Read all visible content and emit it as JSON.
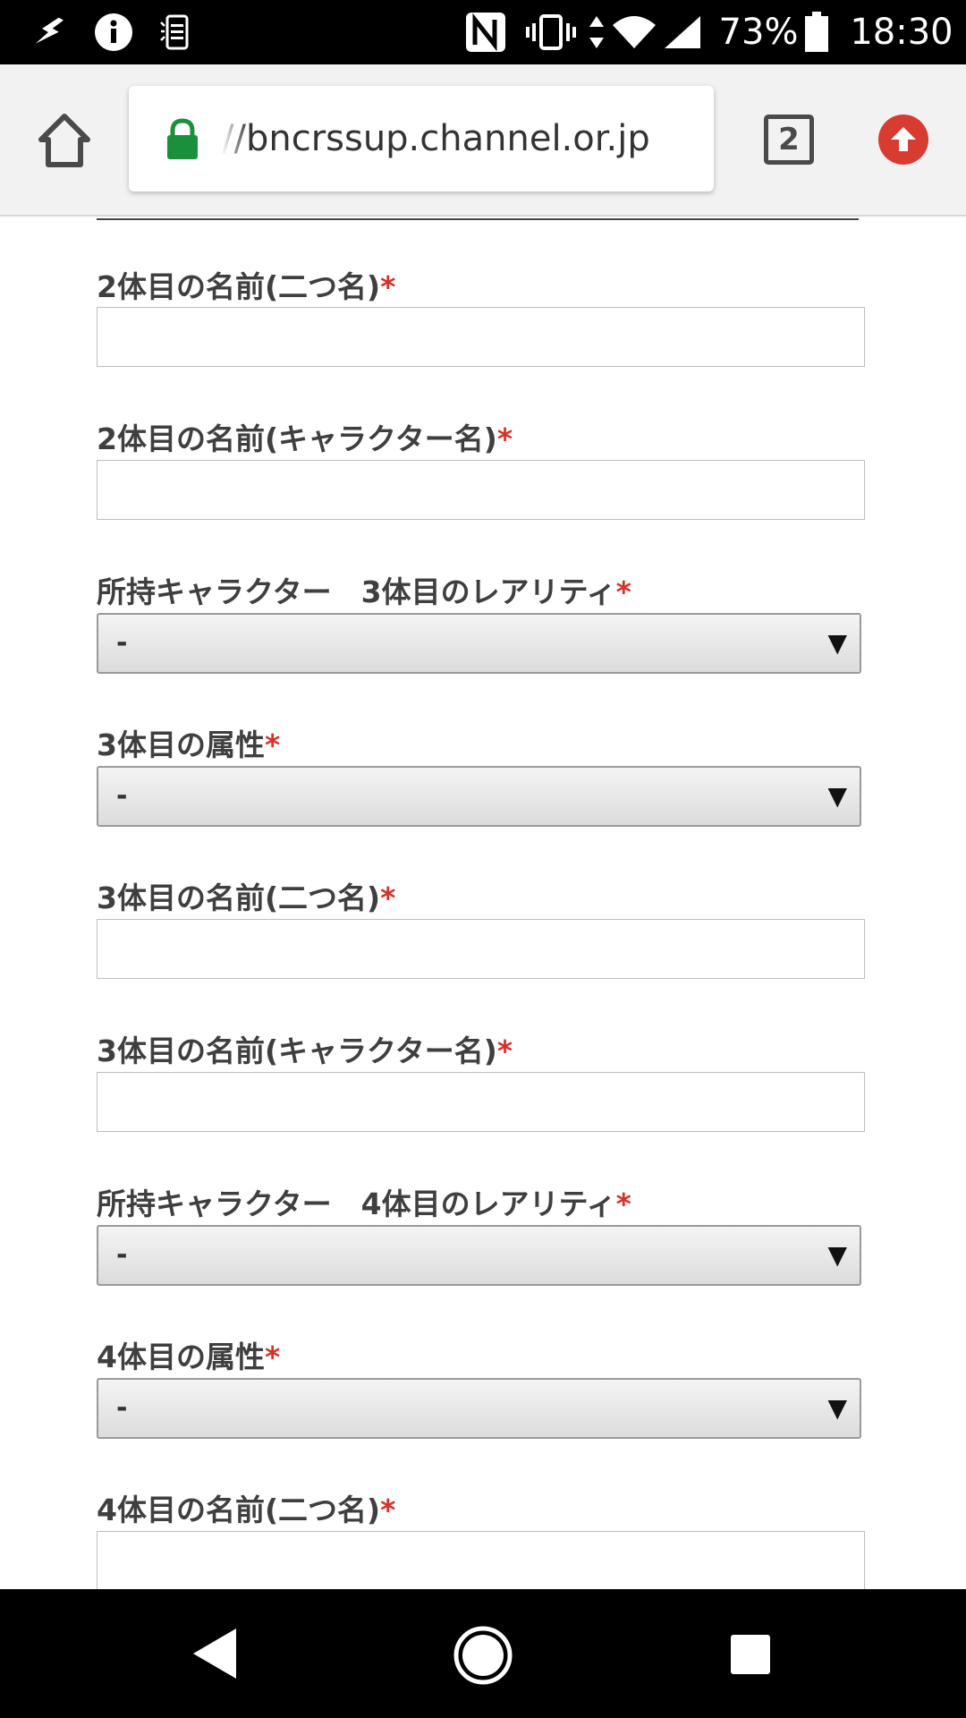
{
  "status_bar": {
    "battery_percent": "73%",
    "time": "18:30",
    "icons": [
      "download-icon",
      "info-icon",
      "notification-icon",
      "nfc-icon",
      "vibrate-icon",
      "data-arrows-icon",
      "wifi-icon",
      "signal-icon",
      "battery-icon"
    ]
  },
  "browser": {
    "url": "https://bncrssup.channel.or.jp",
    "url_visible": "//bncrssup.channel.or.jp",
    "tab_count": "2",
    "lock_color": "#1a8f3c",
    "update_color": "#d83b2f"
  },
  "form": {
    "required_mark": "*",
    "fields": [
      {
        "label": "2体目の名前(二つ名)",
        "type": "text",
        "value": ""
      },
      {
        "label": "2体目の名前(キャラクター名)",
        "type": "text",
        "value": ""
      },
      {
        "label": "所持キャラクター　3体目のレアリティ",
        "type": "select",
        "value": "-"
      },
      {
        "label": "3体目の属性",
        "type": "select",
        "value": "-"
      },
      {
        "label": "3体目の名前(二つ名)",
        "type": "text",
        "value": ""
      },
      {
        "label": "3体目の名前(キャラクター名)",
        "type": "text",
        "value": ""
      },
      {
        "label": "所持キャラクター　4体目のレアリティ",
        "type": "select",
        "value": "-"
      },
      {
        "label": "4体目の属性",
        "type": "select",
        "value": "-"
      },
      {
        "label": "4体目の名前(二つ名)",
        "type": "text",
        "value": ""
      }
    ],
    "select_arrow": "▼"
  },
  "nav_bar": {
    "buttons": [
      "back-button",
      "home-button",
      "recents-button"
    ]
  }
}
